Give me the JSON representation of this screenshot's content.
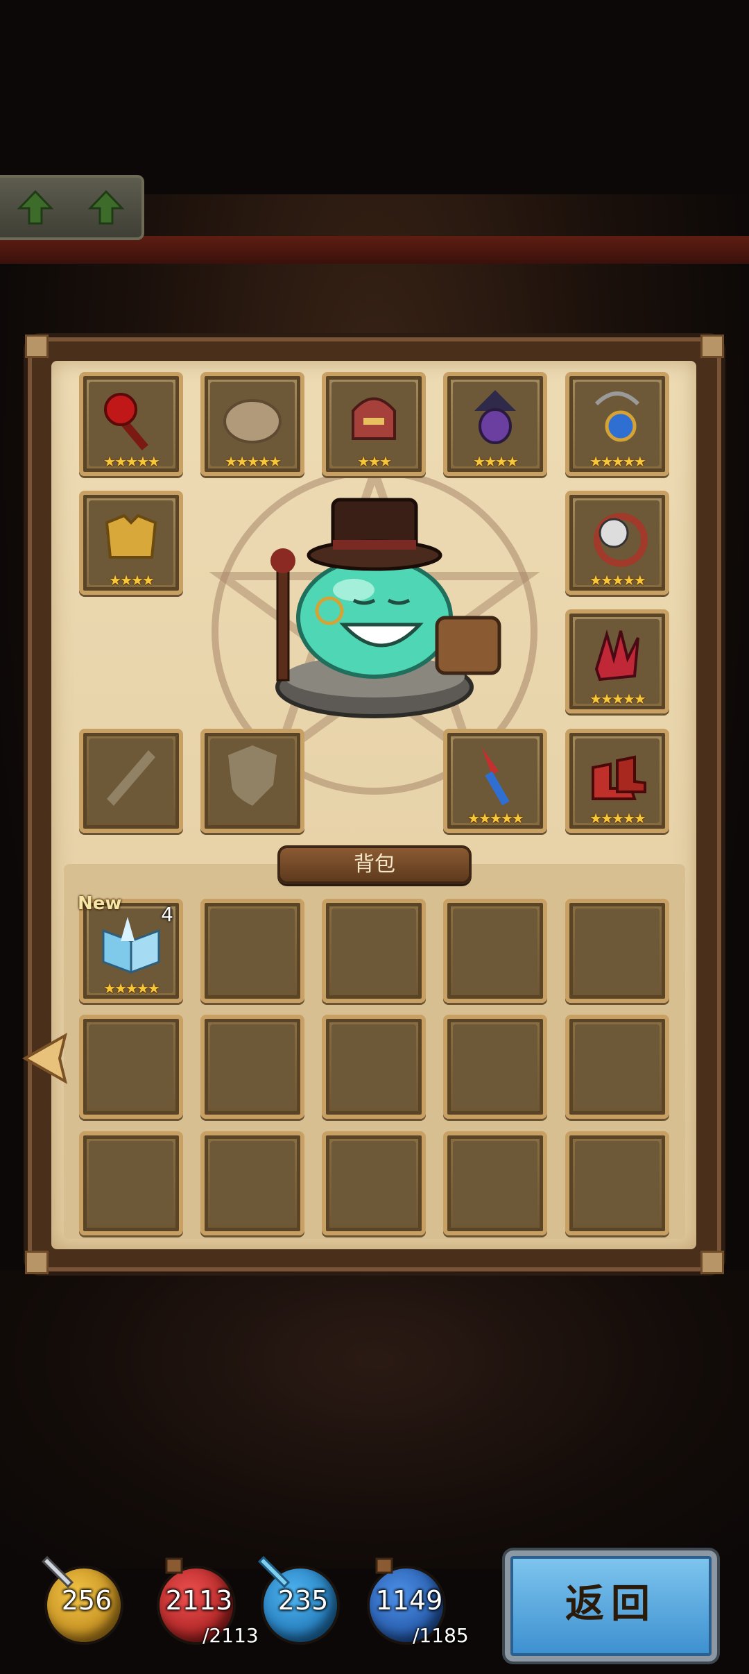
{
  "equipment": {
    "slots": [
      {
        "id": "weapon",
        "stars": "★★★★★",
        "icon": "red-mace-icon",
        "color": "#c01818"
      },
      {
        "id": "cloak",
        "stars": "★★★★★",
        "icon": "cloth-bundle-icon",
        "color": "#b09a7a"
      },
      {
        "id": "helmet",
        "stars": "★★★",
        "icon": "horned-helmet-icon",
        "color": "#a6403a"
      },
      {
        "id": "lantern",
        "stars": "★★★★",
        "icon": "purple-lantern-icon",
        "color": "#6a3fa0"
      },
      {
        "id": "necklace",
        "stars": "★★★★★",
        "icon": "amulet-icon",
        "color": "#2f6fd1"
      },
      {
        "id": "armor",
        "stars": "★★★★",
        "icon": "gold-armor-icon",
        "color": "#d8a83a"
      },
      {
        "id": "ring",
        "stars": "★★★★★",
        "icon": "skull-ring-icon",
        "color": "#a13a2a"
      },
      {
        "id": "gloves",
        "stars": "★★★★★",
        "icon": "red-crystal-gauntlet-icon",
        "color": "#c02838"
      },
      {
        "id": "offhand",
        "stars": "★★★★★",
        "icon": "crystal-dagger-icon",
        "color": "#c43030"
      },
      {
        "id": "boots",
        "stars": "★★★★★",
        "icon": "red-boots-icon",
        "color": "#c0302a"
      }
    ],
    "empty_slots": [
      "sword-slot-placeholder-icon",
      "shield-slot-placeholder-icon"
    ]
  },
  "hero": {
    "name_icon": "slime-gentleman-icon",
    "body_color": "#4fd6b4"
  },
  "backpack": {
    "title": "背包",
    "items": [
      {
        "icon": "ice-book-icon",
        "stars": "★★★★★",
        "count": "4",
        "tag": "New"
      }
    ]
  },
  "stats": [
    {
      "id": "attack",
      "value": "256",
      "max": "",
      "color": "#e0a020",
      "icon": "sword-icon"
    },
    {
      "id": "hp",
      "value": "2113",
      "max": "/2113",
      "color": "#d02a2a",
      "icon": "hp-potion-icon"
    },
    {
      "id": "defense",
      "value": "235",
      "max": "",
      "color": "#1f86d6",
      "icon": "blue-sword-icon"
    },
    {
      "id": "mana",
      "value": "1149",
      "max": "/1185",
      "color": "#2b6fd0",
      "icon": "mp-potion-icon"
    }
  ],
  "buttons": {
    "return_label": "返回"
  }
}
